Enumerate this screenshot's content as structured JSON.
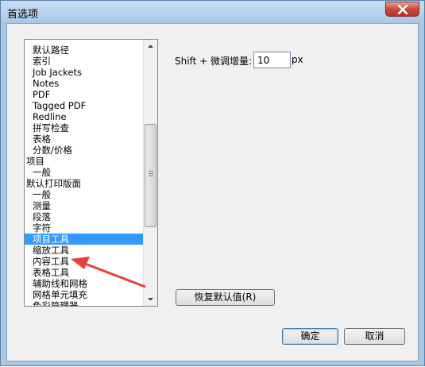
{
  "window": {
    "title": "首选项"
  },
  "list": {
    "items": [
      {
        "label": "默认路径",
        "level": 1,
        "selected": false
      },
      {
        "label": "索引",
        "level": 1,
        "selected": false
      },
      {
        "label": "Job Jackets",
        "level": 1,
        "selected": false
      },
      {
        "label": "Notes",
        "level": 1,
        "selected": false
      },
      {
        "label": "PDF",
        "level": 1,
        "selected": false
      },
      {
        "label": "Tagged PDF",
        "level": 1,
        "selected": false
      },
      {
        "label": "Redline",
        "level": 1,
        "selected": false
      },
      {
        "label": "拼写检查",
        "level": 1,
        "selected": false
      },
      {
        "label": "表格",
        "level": 1,
        "selected": false
      },
      {
        "label": "分数/价格",
        "level": 1,
        "selected": false
      },
      {
        "label": "项目",
        "level": 0,
        "selected": false
      },
      {
        "label": "一般",
        "level": 1,
        "selected": false
      },
      {
        "label": "默认打印版面",
        "level": 0,
        "selected": false
      },
      {
        "label": "一般",
        "level": 1,
        "selected": false
      },
      {
        "label": "测量",
        "level": 1,
        "selected": false
      },
      {
        "label": "段落",
        "level": 1,
        "selected": false
      },
      {
        "label": "字符",
        "level": 1,
        "selected": false
      },
      {
        "label": "项目工具",
        "level": 1,
        "selected": true
      },
      {
        "label": "缩放工具",
        "level": 1,
        "selected": false
      },
      {
        "label": "内容工具",
        "level": 1,
        "selected": false
      },
      {
        "label": "表格工具",
        "level": 1,
        "selected": false
      },
      {
        "label": "辅助线和网格",
        "level": 1,
        "selected": false
      },
      {
        "label": "网格单元填充",
        "level": 1,
        "selected": false
      },
      {
        "label": "色彩管理器",
        "level": 1,
        "selected": false
      }
    ]
  },
  "settings": {
    "shift_label": "Shift + 微调增量:",
    "shift_value": "10",
    "unit": "px"
  },
  "buttons": {
    "restore": "恢复默认值(R)",
    "ok": "确定",
    "cancel": "取消"
  },
  "colors": {
    "selection": "#3399ff",
    "annotation_arrow": "#e8413a"
  }
}
